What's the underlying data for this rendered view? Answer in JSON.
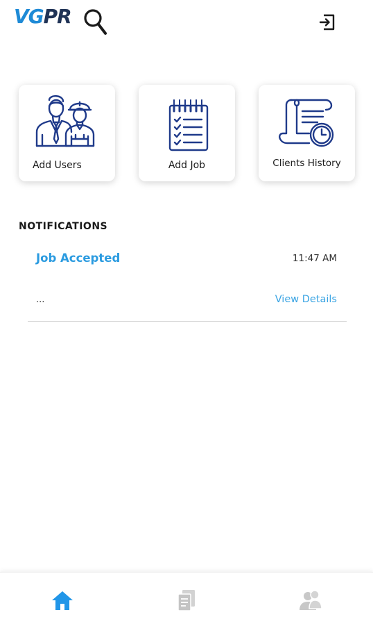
{
  "header": {
    "logo": {
      "part1": "VG",
      "part2": "PR"
    },
    "logout_icon": "logout-icon"
  },
  "actions": [
    {
      "label": "Add Users",
      "icon": "users-icon"
    },
    {
      "label": "Add Job",
      "icon": "clipboard-checklist-icon"
    },
    {
      "label": "Clients History",
      "icon": "history-scroll-icon"
    }
  ],
  "notifications": {
    "title": "NOTIFICATIONS",
    "items": [
      {
        "title": "Job Accepted",
        "time": "11:47 AM",
        "body": "...",
        "link_label": "View Details"
      }
    ]
  },
  "bottom_nav": {
    "items": [
      {
        "icon": "home-icon",
        "active": true
      },
      {
        "icon": "documents-icon",
        "active": false
      },
      {
        "icon": "users-icon",
        "active": false
      }
    ]
  },
  "colors": {
    "accent": "#2b9be0",
    "brand_dark": "#203356",
    "brand_light": "#1e8ad6",
    "inactive_icon": "#c8c8c8"
  }
}
